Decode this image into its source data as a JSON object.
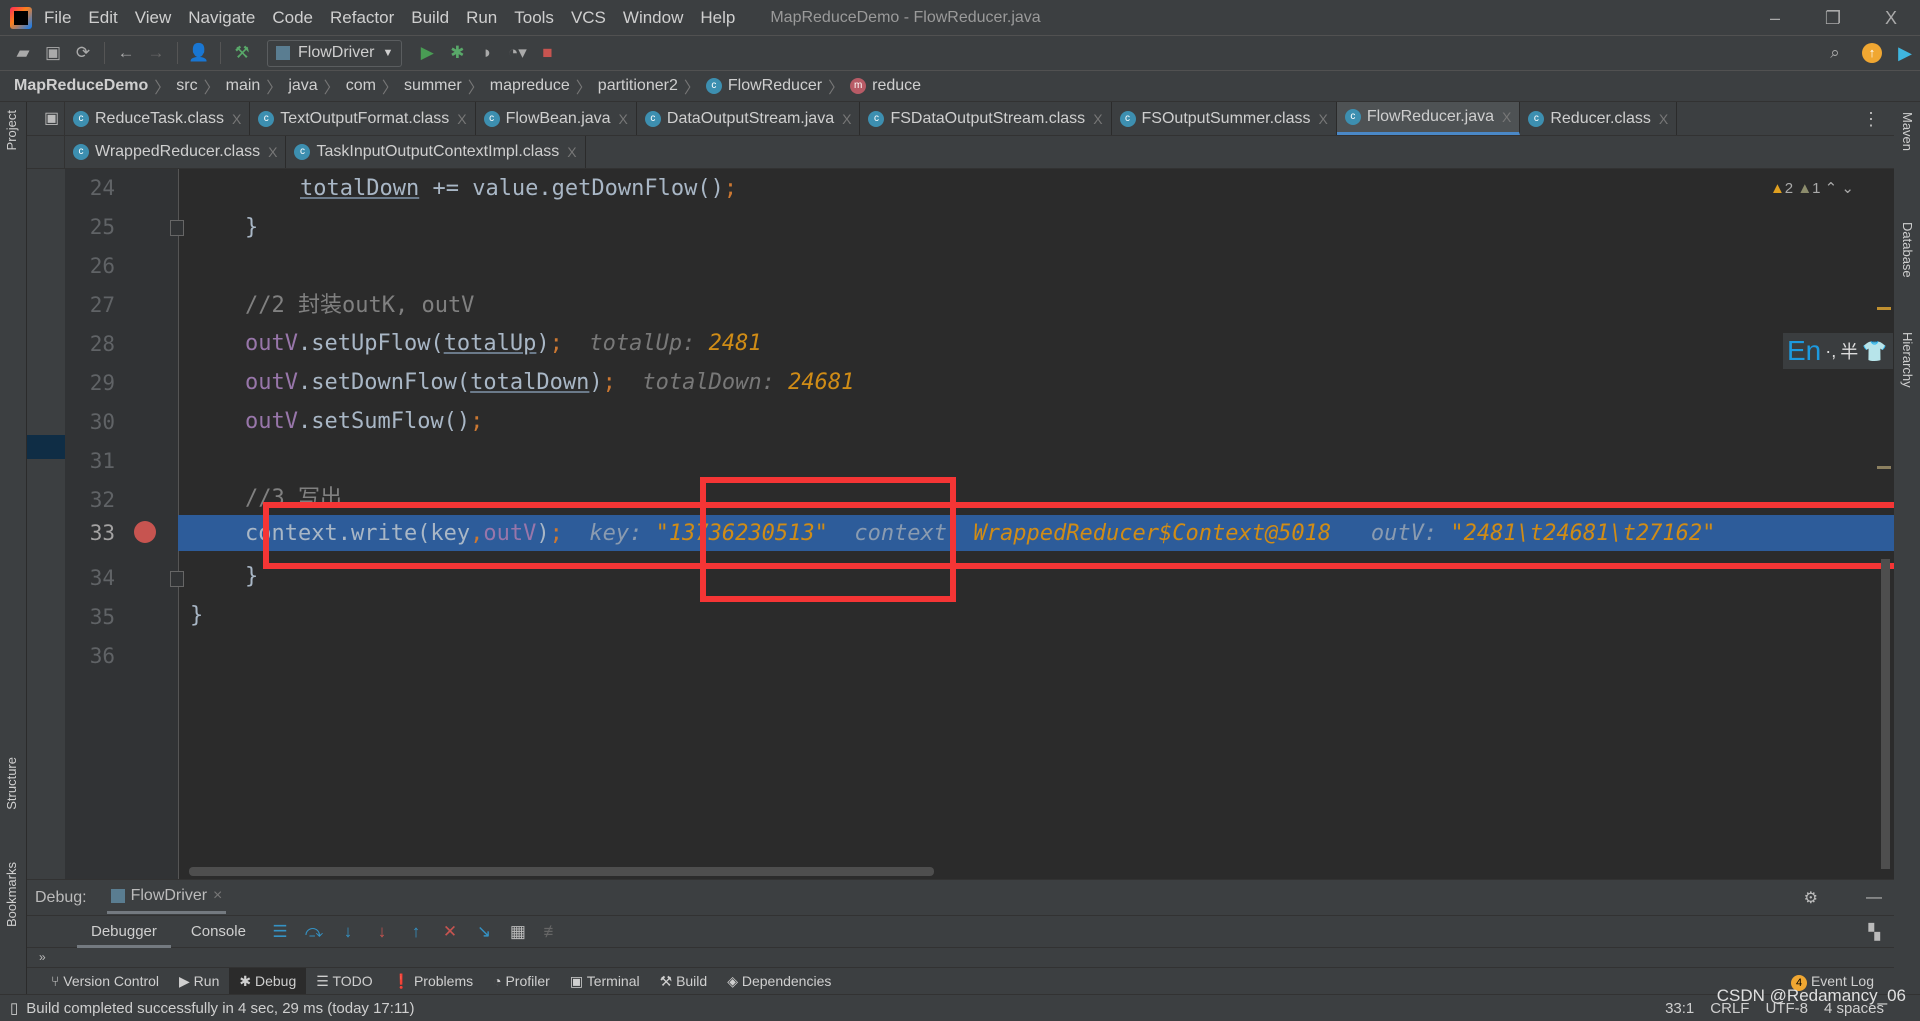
{
  "window": {
    "title": "MapReduceDemo - FlowReducer.java",
    "minimize": "–",
    "restore": "❐",
    "close": "X"
  },
  "menu": [
    "File",
    "Edit",
    "View",
    "Navigate",
    "Code",
    "Refactor",
    "Build",
    "Run",
    "Tools",
    "VCS",
    "Window",
    "Help"
  ],
  "toolbar": {
    "run_config": "FlowDriver"
  },
  "breadcrumb": [
    "MapReduceDemo",
    "src",
    "main",
    "java",
    "com",
    "summer",
    "mapreduce",
    "partitioner2",
    "FlowReducer",
    "reduce"
  ],
  "tabs_row1": [
    {
      "label": "ReduceTask.class"
    },
    {
      "label": "TextOutputFormat.class"
    },
    {
      "label": "FlowBean.java"
    },
    {
      "label": "DataOutputStream.java"
    },
    {
      "label": "FSDataOutputStream.class"
    },
    {
      "label": "FSOutputSummer.class"
    },
    {
      "label": "FlowReducer.java",
      "active": true
    },
    {
      "label": "Reducer.class"
    }
  ],
  "tabs_row2": [
    {
      "label": "WrappedReducer.class"
    },
    {
      "label": "TaskInputOutputContextImpl.class"
    }
  ],
  "side_left": {
    "project": "Project",
    "structure": "Structure",
    "bookmarks": "Bookmarks"
  },
  "side_right": {
    "maven": "Maven",
    "database": "Database",
    "hierarchy": "Hierarchy"
  },
  "inspections": {
    "warnings": "2",
    "weak_warnings": "1"
  },
  "ime": {
    "lang": "En",
    "punct": "·,",
    "width": "半"
  },
  "editor": {
    "line_numbers": [
      "24",
      "25",
      "26",
      "27",
      "28",
      "29",
      "30",
      "31",
      "32",
      "33",
      "34",
      "35",
      "36"
    ],
    "l24": {
      "a": "totalDown",
      "b": " += value.getDownFlow()",
      "c": ";"
    },
    "l25": "}",
    "l27": "//2 封装outK, outV",
    "l28": {
      "a": "outV",
      ".b": "",
      "b": ".setUpFlow(",
      "c": "totalUp",
      "d": ")",
      "e": ";",
      "hint": "totalUp:",
      "val": "2481"
    },
    "l29": {
      "a": "outV",
      "b": ".setDownFlow(",
      "c": "totalDown",
      "d": ")",
      "e": ";",
      "hint": "totalDown:",
      "val": "24681"
    },
    "l30": {
      "a": "outV",
      "b": ".setSumFlow()",
      "e": ";"
    },
    "l32": "//3 写出",
    "l33": {
      "a": "context.write(key",
      "b": ",",
      "c": "outV",
      "d": ")",
      "e": ";",
      "h1": "key:",
      "v1": "\"13736230513\"",
      "h2": "context:",
      "v2": "WrappedReducer$Context@5018",
      "h3": "outV:",
      "v3": "\"2481\\t24681\\t27162\""
    },
    "l34": "}",
    "l35": "}"
  },
  "debug": {
    "label": "Debug:",
    "session": "FlowDriver",
    "tabs": [
      "Debugger",
      "Console"
    ]
  },
  "tool_windows": [
    "Version Control",
    "Run",
    "Debug",
    "TODO",
    "Problems",
    "Profiler",
    "Terminal",
    "Build",
    "Dependencies"
  ],
  "event_log": {
    "count": "4",
    "label": "Event Log"
  },
  "status": {
    "message": "Build completed successfully in 4 sec, 29 ms (today 17:11)",
    "position": "33:1",
    "line_sep": "CRLF",
    "encoding": "UTF-8",
    "indent": "4 spaces"
  },
  "watermark": "CSDN @Redamancy_06",
  "colors": {
    "highlight": "#2d5c9a",
    "annotation": "#f53535",
    "hint_value": "#d08c16",
    "field": "#9876aa"
  }
}
